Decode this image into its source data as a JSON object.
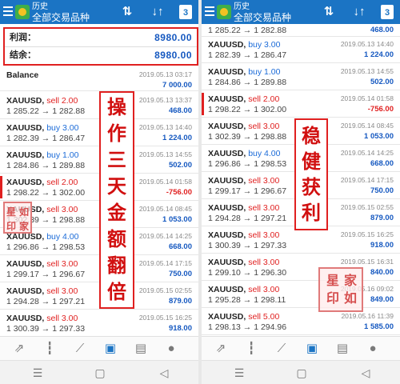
{
  "left": {
    "appbar": {
      "title1": "历史",
      "title2": "全部交易品种",
      "calendar_day": "3"
    },
    "summary": {
      "profit_label": "利润：",
      "profit_value": "8980.00",
      "balance_label": "结余：",
      "balance_value": "8980.00"
    },
    "balance_row": {
      "label": "Balance",
      "datetime": "2019.05.13 03:17",
      "amount": "7 000.00"
    },
    "trades": [
      {
        "symbol": "XAUUSD,",
        "action": "sell 2.00",
        "side": "sell",
        "prices": "1 285.22 → 1 282.88",
        "datetime": "2019.05.13 13:37",
        "pl": "468.00",
        "pl_sign": "pos"
      },
      {
        "symbol": "XAUUSD,",
        "action": "buy 3.00",
        "side": "buy",
        "prices": "1 282.39 → 1 286.47",
        "datetime": "2019.05.13 14:40",
        "pl": "1 224.00",
        "pl_sign": "pos"
      },
      {
        "symbol": "XAUUSD,",
        "action": "buy 1.00",
        "side": "buy",
        "prices": "1 284.86 → 1 289.88",
        "datetime": "2019.05.13 14:55",
        "pl": "502.00",
        "pl_sign": "pos"
      },
      {
        "symbol": "XAUUSD,",
        "action": "sell 2.00",
        "side": "sell",
        "prices": "1 298.22 → 1 302.00",
        "datetime": "2019.05.14 01:58",
        "pl": "-756.00",
        "pl_sign": "neg"
      },
      {
        "symbol": "XAUUSD,",
        "action": "sell 3.00",
        "side": "sell",
        "prices": "1 302.39 → 1 298.88",
        "datetime": "2019.05.14 08:45",
        "pl": "1 053.00",
        "pl_sign": "pos"
      },
      {
        "symbol": "XAUUSD,",
        "action": "buy 4.00",
        "side": "buy",
        "prices": "1 296.86 → 1 298.53",
        "datetime": "2019.05.14 14:25",
        "pl": "668.00",
        "pl_sign": "pos"
      },
      {
        "symbol": "XAUUSD,",
        "action": "sell 3.00",
        "side": "sell",
        "prices": "1 299.17 → 1 296.67",
        "datetime": "2019.05.14 17:15",
        "pl": "750.00",
        "pl_sign": "pos"
      },
      {
        "symbol": "XAUUSD,",
        "action": "sell 3.00",
        "side": "sell",
        "prices": "1 294.28 → 1 297.21",
        "datetime": "2019.05.15 02:55",
        "pl": "879.00",
        "pl_sign": "pos"
      },
      {
        "symbol": "XAUUSD,",
        "action": "sell 3.00",
        "side": "sell",
        "prices": "1 300.39 → 1 297.33",
        "datetime": "2019.05.15 16:25",
        "pl": "918.00",
        "pl_sign": "pos"
      }
    ],
    "banner_chars": [
      "操",
      "作",
      "三",
      "天",
      "金",
      "额",
      "翻",
      "倍"
    ],
    "seal_chars": [
      "星",
      "如",
      "印",
      "家"
    ]
  },
  "right": {
    "appbar": {
      "title1": "历史",
      "title2": "全部交易品种",
      "calendar_day": "3"
    },
    "top_partial": {
      "prices": "1 285.22 → 1 282.88",
      "pl": "468.00"
    },
    "trades": [
      {
        "symbol": "XAUUSD,",
        "action": "buy 3.00",
        "side": "buy",
        "prices": "1 282.39 → 1 286.47",
        "datetime": "2019.05.13 14:40",
        "pl": "1 224.00",
        "pl_sign": "pos"
      },
      {
        "symbol": "XAUUSD,",
        "action": "buy 1.00",
        "side": "buy",
        "prices": "1 284.86 → 1 289.88",
        "datetime": "2019.05.13 14:55",
        "pl": "502.00",
        "pl_sign": "pos"
      },
      {
        "symbol": "XAUUSD,",
        "action": "sell 2.00",
        "side": "sell",
        "prices": "1 298.22 → 1 302.00",
        "datetime": "2019.05.14 01:58",
        "pl": "-756.00",
        "pl_sign": "neg"
      },
      {
        "symbol": "XAUUSD,",
        "action": "sell 3.00",
        "side": "sell",
        "prices": "1 302.39 → 1 298.88",
        "datetime": "2019.05.14 08:45",
        "pl": "1 053.00",
        "pl_sign": "pos"
      },
      {
        "symbol": "XAUUSD,",
        "action": "buy 4.00",
        "side": "buy",
        "prices": "1 296.86 → 1 298.53",
        "datetime": "2019.05.14 14:25",
        "pl": "668.00",
        "pl_sign": "pos"
      },
      {
        "symbol": "XAUUSD,",
        "action": "sell 3.00",
        "side": "sell",
        "prices": "1 299.17 → 1 296.67",
        "datetime": "2019.05.14 17:15",
        "pl": "750.00",
        "pl_sign": "pos"
      },
      {
        "symbol": "XAUUSD,",
        "action": "sell 3.00",
        "side": "sell",
        "prices": "1 294.28 → 1 297.21",
        "datetime": "2019.05.15 02:55",
        "pl": "879.00",
        "pl_sign": "pos"
      },
      {
        "symbol": "XAUUSD,",
        "action": "sell 3.00",
        "side": "sell",
        "prices": "1 300.39 → 1 297.33",
        "datetime": "2019.05.15 16:25",
        "pl": "918.00",
        "pl_sign": "pos"
      },
      {
        "symbol": "XAUUSD,",
        "action": "sell 3.00",
        "side": "sell",
        "prices": "1 299.10 → 1 296.30",
        "datetime": "2019.05.15 16:31",
        "pl": "840.00",
        "pl_sign": "pos"
      },
      {
        "symbol": "XAUUSD,",
        "action": "sell 3.00",
        "side": "sell",
        "prices": "1 295.28 → 1 298.11",
        "datetime": "2019.05.16 09:02",
        "pl": "849.00",
        "pl_sign": "pos"
      },
      {
        "symbol": "XAUUSD,",
        "action": "sell 5.00",
        "side": "sell",
        "prices": "1 298.13 → 1 294.96",
        "datetime": "2019.05.16 11:39",
        "pl": "1 585.00",
        "pl_sign": "pos"
      }
    ],
    "banner_chars": [
      "稳",
      "健",
      "获",
      "利"
    ],
    "seal_chars": [
      "星",
      "家",
      "印",
      "如"
    ]
  },
  "colors": {
    "appbar": "#1b74c4",
    "buy": "#1b6bd8",
    "sell": "#e02020",
    "profit": "#1558c0",
    "banner_border": "#e02020"
  },
  "icons": {
    "toolbar": [
      "chart-trend-icon",
      "candlestick-icon",
      "line-chart-icon",
      "inbox-icon",
      "news-icon",
      "chat-icon"
    ],
    "navbar": [
      "menu-lines-icon",
      "home-rounded-icon",
      "back-arrow-icon"
    ]
  }
}
